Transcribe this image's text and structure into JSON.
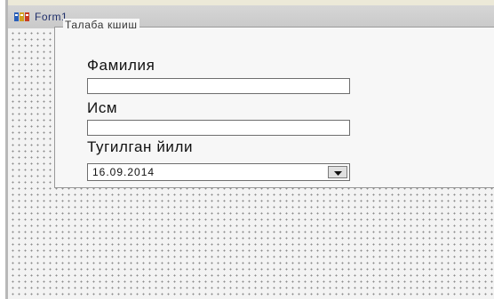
{
  "window": {
    "title": "Form1",
    "icon": "delphi-form-icon"
  },
  "groupbox": {
    "caption": "Талаба кшиш"
  },
  "fields": {
    "surname": {
      "label": "Фамилия",
      "value": ""
    },
    "name": {
      "label": "Исм",
      "value": ""
    },
    "birth_year": {
      "label": "Тугилган йили",
      "value": "16.09.2014",
      "icon": "chevron-down-icon"
    }
  },
  "colors": {
    "title_text": "#1f2f6b",
    "canvas": "#f3f3f3",
    "grid_dot": "#8a8a8a"
  }
}
